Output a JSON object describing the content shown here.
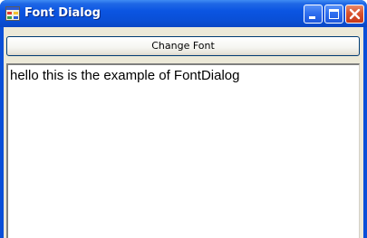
{
  "window": {
    "title": "Font Dialog",
    "title_color": "#ffffff",
    "titlebar_color": "#0a4fd8",
    "app_icon": "form-icon"
  },
  "caption_buttons": {
    "minimize_icon": "minimize-icon",
    "maximize_icon": "maximize-icon",
    "close_icon": "close-icon",
    "close_color": "#d9532e"
  },
  "main": {
    "change_font_label": "Change Font",
    "text_content": "hello this is the example of FontDialog"
  }
}
